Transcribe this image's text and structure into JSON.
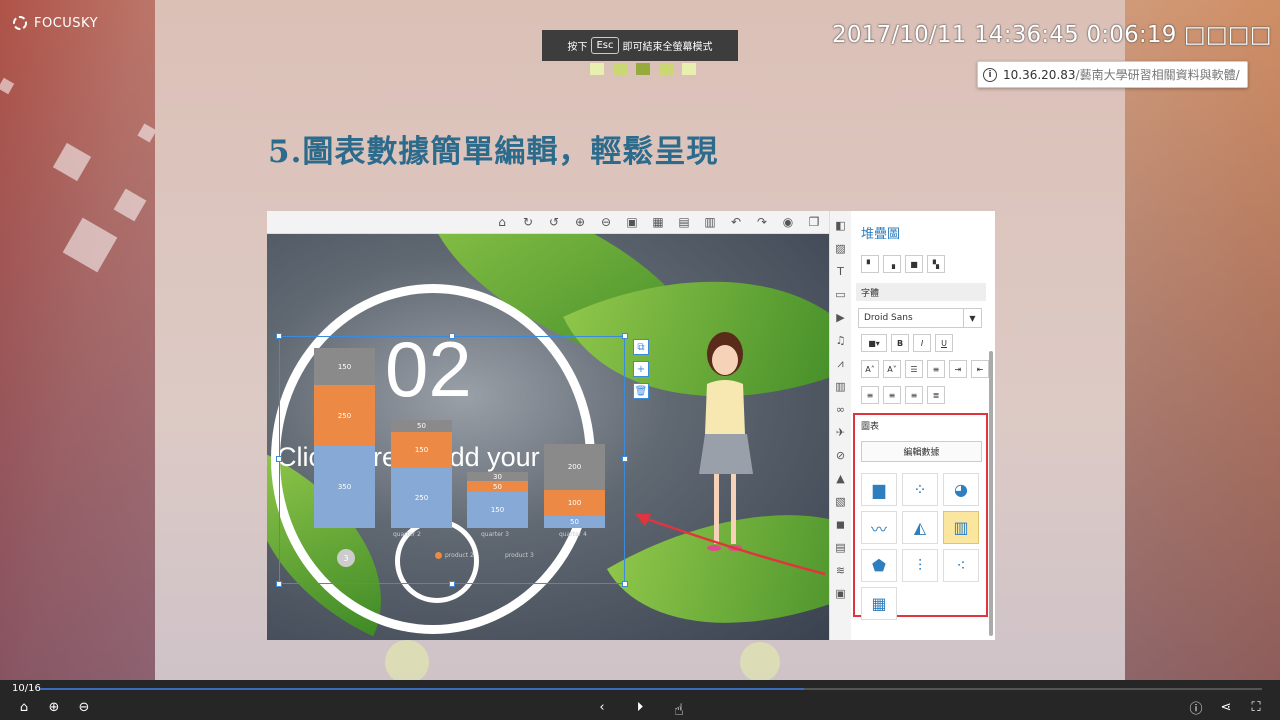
{
  "app": {
    "brand": "FOCUSKY"
  },
  "esc_tip": {
    "prefix": "按下",
    "key": "Esc",
    "suffix": "即可結束全螢幕模式"
  },
  "clock": "2017/10/11 14:36:45 0:06:19 □□□□",
  "url": {
    "host": "10.36.20.83",
    "path": "/藝南大學研習相關資料與軟體/"
  },
  "slide": {
    "title": "5.圖表數據簡單編輯，輕鬆呈現"
  },
  "canvas": {
    "big_number": "02",
    "placeholder_text": "Click here to add your",
    "chart_labels": {
      "stack1": [
        "150",
        "250",
        "350"
      ],
      "stack2": [
        "50",
        "150",
        "250"
      ],
      "stack3": [
        "30",
        "50",
        "150"
      ],
      "stack4": [
        "200",
        "100",
        "50"
      ]
    },
    "categories": [
      "quarter 2",
      "quarter 3",
      "quarter 4"
    ],
    "legend": [
      "product 2",
      "product 3"
    ],
    "page_indicator": "3"
  },
  "panel": {
    "title": "堆疊圖",
    "font_section": "字體",
    "font_name": "Droid Sans",
    "chart_section": "圖表",
    "edit_data_button": "編輯數據",
    "bold": "B",
    "italic": "I",
    "underline": "U"
  },
  "player": {
    "page": "10/16",
    "progress": 0.625
  },
  "colors": {
    "accent": "#2f7fbf",
    "highlight_border": "#e0353e",
    "title": "#2c6b8c"
  }
}
